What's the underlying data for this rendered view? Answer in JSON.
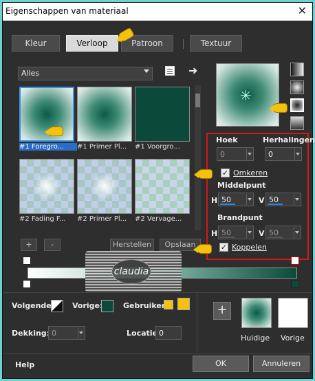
{
  "window": {
    "title": "Eigenschappen van materiaal",
    "close_glyph": "✕"
  },
  "tabs": [
    "Kleur",
    "Verloop",
    "Patroon",
    "Textuur"
  ],
  "active_tab": "Verloop",
  "category": {
    "selected": "Alles"
  },
  "thumbnails": [
    {
      "label": "#1 Foregro...",
      "style": "radial",
      "selected": true
    },
    {
      "label": "#1 Primer Pl...",
      "style": "radial",
      "selected": false
    },
    {
      "label": "#1 Voorgro...",
      "style": "solid",
      "selected": false
    },
    {
      "label": "#2 Fading F...",
      "style": "check",
      "selected": false
    },
    {
      "label": "#2 Primer Pl...",
      "style": "check",
      "selected": false
    },
    {
      "label": "#2 Vervage...",
      "style": "check2",
      "selected": false
    }
  ],
  "list_buttons": {
    "add": "+",
    "remove": "-",
    "restore": "Herstellen",
    "save": "Opslaan"
  },
  "settings": {
    "angle_label": "Hoek",
    "angle_value": "0",
    "repeats_label": "Herhalingen",
    "repeats_value": "0",
    "invert_label": "Omkeren",
    "invert_checked": true,
    "center_label": "Middelpunt",
    "center_h": "50",
    "center_v": "50",
    "focal_label": "Brandpunt",
    "focal_h": "50",
    "focal_v": "50",
    "link_label": "Koppelen",
    "link_checked": true,
    "h_label": "H",
    "v_label": "V"
  },
  "watermark": {
    "text": "claudia"
  },
  "bottom": {
    "next_label": "Volgende:",
    "prev_label": "Vorige:",
    "user_label": "Gebruiker:",
    "opacity_label": "Dekking:",
    "opacity_value": "0",
    "location_label": "Locatie:",
    "location_value": "0",
    "current_label": "Huidige",
    "previous_label": "Vorige",
    "add_glyph": "+"
  },
  "footer": {
    "help": "Help",
    "ok": "OK",
    "cancel": "Annuleren"
  },
  "colors": {
    "foreground": "#0b4a3a",
    "background": "#ffffff",
    "accent": "#d21818",
    "user_color": "#f4c20d"
  }
}
